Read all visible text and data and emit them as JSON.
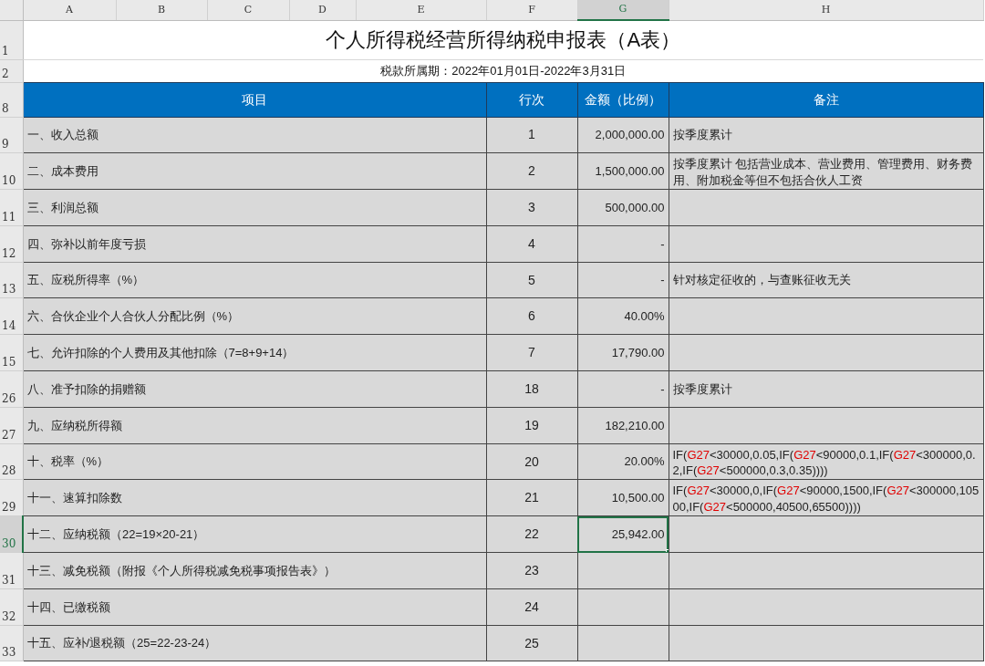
{
  "column_headers": [
    {
      "label": "A",
      "selected": false
    },
    {
      "label": "B",
      "selected": false
    },
    {
      "label": "C",
      "selected": false
    },
    {
      "label": "D",
      "selected": false
    },
    {
      "label": "E",
      "selected": false
    },
    {
      "label": "F",
      "selected": false
    },
    {
      "label": "G",
      "selected": true
    },
    {
      "label": "H",
      "selected": false
    }
  ],
  "title_row": {
    "row_number": "1",
    "text": "个人所得税经营所得纳税申报表（A表）"
  },
  "period_row": {
    "row_number": "2",
    "text": "税款所属期：2022年01月01日-2022年3月31日"
  },
  "header_row": {
    "row_number": "8",
    "columns": [
      "项目",
      "行次",
      "金额（比例）",
      "备注"
    ]
  },
  "rows": [
    {
      "row_number": "9",
      "item": "一、收入总额",
      "line": "1",
      "amount": "2,000,000.00",
      "selected": false,
      "remark": [
        {
          "kind": "text",
          "text": "按季度累计"
        }
      ]
    },
    {
      "row_number": "10",
      "item": "二、成本费用",
      "line": "2",
      "amount": "1,500,000.00",
      "selected": false,
      "remark": [
        {
          "kind": "text",
          "text": "按季度累计 包括营业成本、营业费用、管理费用、财务费用、附加税金等但不包括合伙人工资"
        }
      ]
    },
    {
      "row_number": "11",
      "item": "三、利润总额",
      "line": "3",
      "amount": "500,000.00",
      "selected": false
    },
    {
      "row_number": "12",
      "item": "四、弥补以前年度亏损",
      "line": "4",
      "amount": "-",
      "selected": false
    },
    {
      "row_number": "13",
      "item": "五、应税所得率（%）",
      "line": "5",
      "amount": "-",
      "selected": false,
      "remark": [
        {
          "kind": "text",
          "text": "针对核定征收的，与查账征收无关"
        }
      ]
    },
    {
      "row_number": "14",
      "item": "六、合伙企业个人合伙人分配比例（%）",
      "line": "6",
      "amount": "40.00%",
      "selected": false
    },
    {
      "row_number": "15",
      "item": "七、允许扣除的个人费用及其他扣除（7=8+9+14）",
      "line": "7",
      "amount": "17,790.00",
      "selected": false
    },
    {
      "row_number": "26",
      "item": "八、准予扣除的捐赠额",
      "line": "18",
      "amount": "-",
      "selected": false,
      "remark": [
        {
          "kind": "text",
          "text": "按季度累计"
        }
      ]
    },
    {
      "row_number": "27",
      "item": "九、应纳税所得额",
      "line": "19",
      "amount": "182,210.00",
      "selected": false
    },
    {
      "row_number": "28",
      "item": "十、税率（%）",
      "line": "20",
      "amount": "20.00%",
      "selected": false,
      "remark": [
        {
          "kind": "text",
          "text": "IF("
        },
        {
          "kind": "ref",
          "text": "G27"
        },
        {
          "kind": "text",
          "text": "<30000,0.05,IF("
        },
        {
          "kind": "ref",
          "text": "G27"
        },
        {
          "kind": "text",
          "text": "<90000,0.1,IF("
        },
        {
          "kind": "ref",
          "text": "G27"
        },
        {
          "kind": "text",
          "text": "<300000,0.2,IF("
        },
        {
          "kind": "ref",
          "text": "G27"
        },
        {
          "kind": "text",
          "text": "<500000,0.3,0.35))))"
        }
      ]
    },
    {
      "row_number": "29",
      "item": "十一、速算扣除数",
      "line": "21",
      "amount": "10,500.00",
      "selected": false,
      "remark": [
        {
          "kind": "text",
          "text": "IF("
        },
        {
          "kind": "ref",
          "text": "G27"
        },
        {
          "kind": "text",
          "text": "<30000,0,IF("
        },
        {
          "kind": "ref",
          "text": "G27"
        },
        {
          "kind": "text",
          "text": "<90000,1500,IF("
        },
        {
          "kind": "ref",
          "text": "G27"
        },
        {
          "kind": "text",
          "text": "<300000,10500,IF("
        },
        {
          "kind": "ref",
          "text": "G27"
        },
        {
          "kind": "text",
          "text": "<500000,40500,65500))))"
        }
      ]
    },
    {
      "row_number": "30",
      "item": "十二、应纳税额（22=19×20-21）",
      "line": "22",
      "amount": "25,942.00",
      "selected": true
    },
    {
      "row_number": "31",
      "item": "十三、减免税额（附报《个人所得税减免税事项报告表》）",
      "line": "23",
      "selected": false
    },
    {
      "row_number": "32",
      "item": "十四、已缴税额",
      "line": "24",
      "selected": false
    },
    {
      "row_number": "33",
      "item": "十五、应补/退税额（25=22-23-24）",
      "line": "25",
      "selected": false
    }
  ]
}
